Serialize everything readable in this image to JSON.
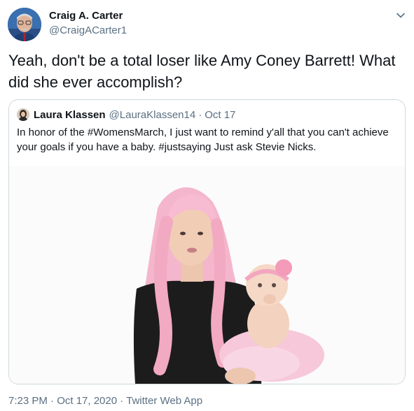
{
  "tweet": {
    "author": {
      "name": "Craig A. Carter",
      "handle": "@CraigACarter1"
    },
    "text": "Yeah, don't be a total loser like Amy Coney Barrett! What did she ever accomplish?",
    "timestamp": "7:23 PM · Oct 17, 2020 · Twitter Web App",
    "menu_icon": "chevron-down-icon"
  },
  "quoted_tweet": {
    "author": {
      "name": "Laura Klassen",
      "handle": "@LauraKlassen14"
    },
    "separator": "·",
    "date": "Oct 17",
    "text": "In honor of the #WomensMarch, I just want to remind y'all that you can't achieve your goals if you have a baby. #justsaying Just ask Stevie Nicks."
  },
  "colors": {
    "text": "#0f1419",
    "secondary": "#5b7083",
    "border": "#cfd9de"
  }
}
